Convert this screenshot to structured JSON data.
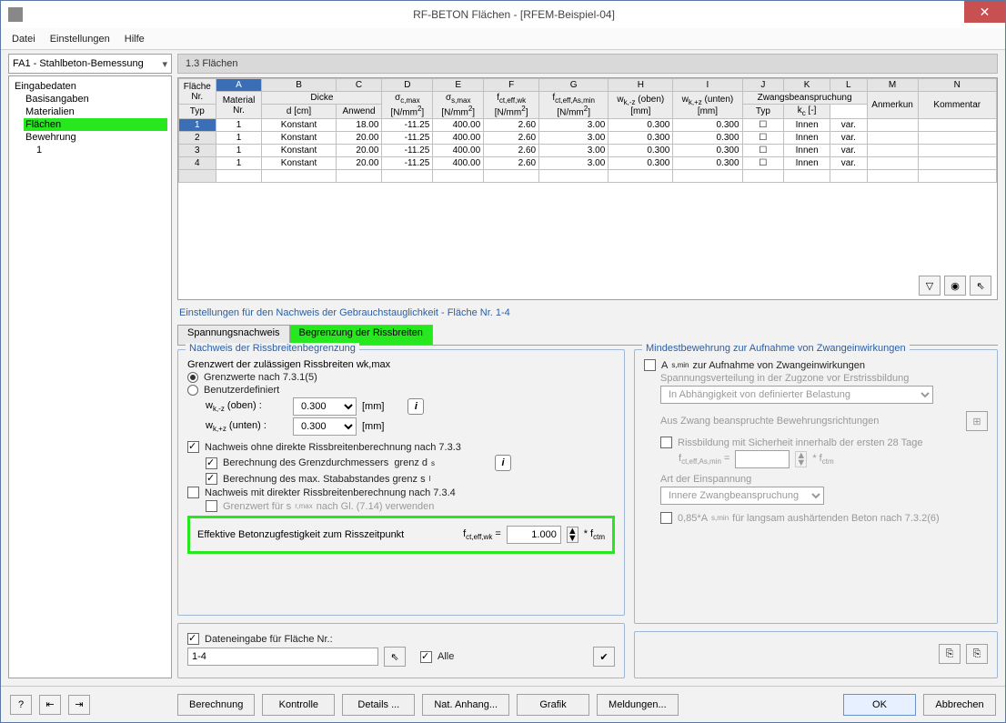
{
  "window_title": "RF-BETON Flächen - [RFEM-Beispiel-04]",
  "menus": {
    "file": "Datei",
    "settings": "Einstellungen",
    "help": "Hilfe"
  },
  "combo_case": "FA1 - Stahlbeton-Bemessung",
  "tree": {
    "root": "Eingabedaten",
    "n1": "Basisangaben",
    "n2": "Materialien",
    "n3": "Flächen",
    "n4": "Bewehrung",
    "n5": "1"
  },
  "section_title": "1.3 Flächen",
  "col_letters": [
    "A",
    "B",
    "C",
    "D",
    "E",
    "F",
    "G",
    "H",
    "I",
    "J",
    "K",
    "L",
    "M",
    "N"
  ],
  "headers": {
    "surface_no": "Fläche\nNr.",
    "material_no": "Material\nNr.",
    "thickness": "Dicke",
    "type": "Typ",
    "d": "d [cm]",
    "sigma_c": "σc,max\n[N/mm²]",
    "sigma_s": "σs,max\n[N/mm²]",
    "fct_wk": "fct,eff,wk\n[N/mm²]",
    "fct_asmin": "fct,eff,As,min\n[N/mm²]",
    "wkz_oben": "wk,-z (oben)\n[mm]",
    "wkz_unten": "wk,+z (unten)\n[mm]",
    "restraint": "Zwangsbeanspruchung",
    "anwend": "Anwend",
    "restraint_type": "Typ",
    "kc": "kc [-]",
    "anmerkun": "Anmerkun",
    "kommentar": "Kommentar"
  },
  "rows": [
    {
      "no": "1",
      "mat": "1",
      "typ": "Konstant",
      "d": "18.00",
      "sc": "-11.25",
      "ss": "400.00",
      "fwk": "2.60",
      "fas": "3.00",
      "wz1": "0.300",
      "wz2": "0.300",
      "anw": "☐",
      "rty": "Innen",
      "kc": "var."
    },
    {
      "no": "2",
      "mat": "1",
      "typ": "Konstant",
      "d": "20.00",
      "sc": "-11.25",
      "ss": "400.00",
      "fwk": "2.60",
      "fas": "3.00",
      "wz1": "0.300",
      "wz2": "0.300",
      "anw": "☐",
      "rty": "Innen",
      "kc": "var."
    },
    {
      "no": "3",
      "mat": "1",
      "typ": "Konstant",
      "d": "20.00",
      "sc": "-11.25",
      "ss": "400.00",
      "fwk": "2.60",
      "fas": "3.00",
      "wz1": "0.300",
      "wz2": "0.300",
      "anw": "☐",
      "rty": "Innen",
      "kc": "var."
    },
    {
      "no": "4",
      "mat": "1",
      "typ": "Konstant",
      "d": "20.00",
      "sc": "-11.25",
      "ss": "400.00",
      "fwk": "2.60",
      "fas": "3.00",
      "wz1": "0.300",
      "wz2": "0.300",
      "anw": "☐",
      "rty": "Innen",
      "kc": "var."
    }
  ],
  "settings_caption": "Einstellungen für den Nachweis der Gebrauchstauglichkeit - Fläche Nr. 1-4",
  "tabs": {
    "t1": "Spannungsnachweis",
    "t2": "Begrenzung der Rissbreiten"
  },
  "gb1_title": "Nachweis der Rissbreitenbegrenzung",
  "lbl_grenzwert": "Grenzwert der zulässigen Rissbreiten wk,max",
  "opt_7315": "Grenzwerte nach 7.3.1(5)",
  "opt_user": "Benutzerdefiniert",
  "lbl_wk_oben": "wk,-z (oben) :",
  "lbl_wk_unten": "wk,+z (unten) :",
  "val_wk_oben": "0.300",
  "val_wk_unten": "0.300",
  "unit_mm": "[mm]",
  "chk_733": "Nachweis ohne direkte Rissbreitenberechnung nach 7.3.3",
  "chk_ds": "Berechnung des Grenzdurchmessers  grenz ds",
  "chk_sl": "Berechnung des max. Stababstandes grenz sl",
  "chk_734": "Nachweis mit direkter Rissbreitenberechnung nach 7.3.4",
  "chk_714": "Grenzwert für sr,max nach Gl. (7.14) verwenden",
  "lbl_eff_beton": "Effektive Betonzugfestigkeit zum Risszeitpunkt",
  "lbl_fctwk": "fct,eff,wk =",
  "val_fctwk": "1.000",
  "lbl_fctm": "* fctm",
  "chk_data_input": "Dateneingabe für Fläche Nr.:",
  "val_data_input": "1-4",
  "chk_alle": "Alle",
  "gb2_title": "Mindestbewehrung zur Aufnahme von Zwangeinwirkungen",
  "chk_asmin": "As,min zur Aufnahme von Zwangeinwirkungen",
  "lbl_spannungsvert": "Spannungsverteilung in der Zugzone vor Erstrissbildung",
  "val_spannungsvert": "In Abhängigkeit von definierter Belastung",
  "lbl_zwang_dir": "Aus Zwang beanspruchte Bewehrungsrichtungen",
  "chk_rissbildung": "Rissbildung mit Sicherheit innerhalb der ersten 28 Tage",
  "lbl_fct_asmin": "fct,eff,As,min =",
  "lbl_art": "Art der Einspannung",
  "val_art": "Innere Zwangbeanspruchung",
  "chk_085": "0,85*As,min für langsam aushärtenden Beton nach 7.3.2(6)",
  "buttons": {
    "berechnung": "Berechnung",
    "kontrolle": "Kontrolle",
    "details": "Details ...",
    "nat_anhang": "Nat. Anhang...",
    "grafik": "Grafik",
    "meldungen": "Meldungen...",
    "ok": "OK",
    "abbrechen": "Abbrechen"
  }
}
